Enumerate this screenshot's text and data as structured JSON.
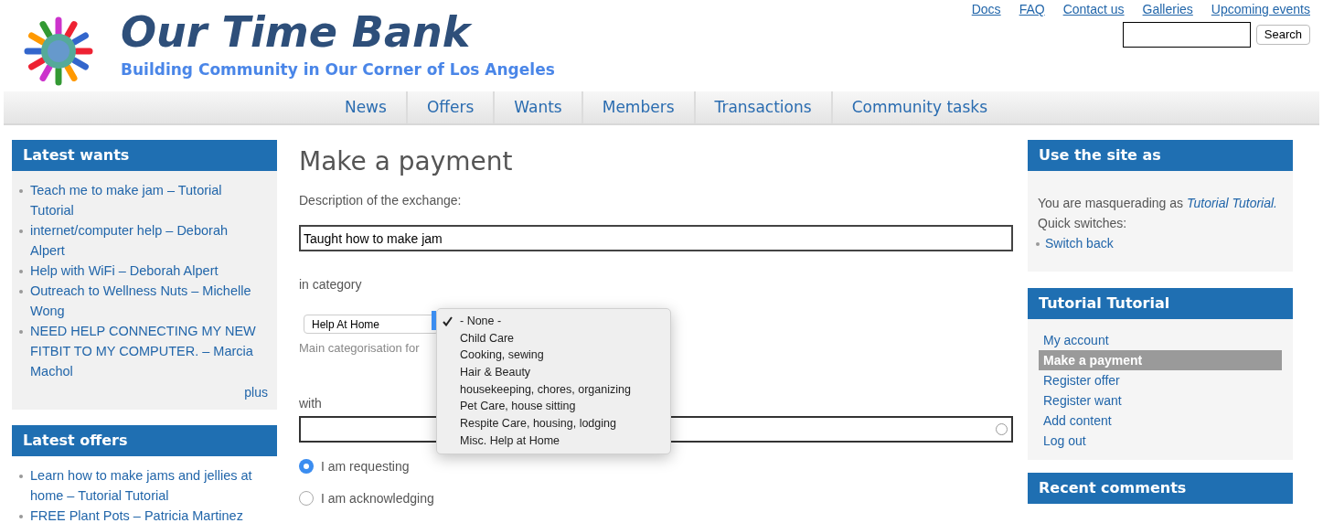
{
  "site": {
    "title": "Our Time Bank",
    "slogan": "Building Community in Our Corner of Los Angeles"
  },
  "top_links": [
    "Docs",
    "FAQ",
    "Contact us",
    "Galleries",
    "Upcoming events"
  ],
  "search": {
    "button": "Search"
  },
  "nav": [
    "News",
    "Offers",
    "Wants",
    "Members",
    "Transactions",
    "Community tasks"
  ],
  "latest_wants": {
    "title": "Latest wants",
    "items": [
      "Teach me to make jam – Tutorial Tutorial",
      "internet/computer help – Deborah Alpert",
      "Help with WiFi – Deborah Alpert",
      "Outreach to Wellness Nuts – Michelle Wong",
      "NEED HELP CONNECTING MY NEW FITBIT TO MY COMPUTER. – Marcia Machol"
    ],
    "more": "plus"
  },
  "latest_offers": {
    "title": "Latest offers",
    "items": [
      "Learn how to make jams and jellies at home – Tutorial Tutorial",
      "FREE Plant Pots – Patricia Martinez"
    ]
  },
  "form": {
    "title": "Make a payment",
    "description_label": "Description of the exchange:",
    "description_value": "Taught how to make jam",
    "category_label": "in category",
    "category_value": "Help At Home",
    "category_help": "Main categorisation for",
    "with_label": "with",
    "category_options": [
      {
        "label": "- None -",
        "selected": true
      },
      {
        "label": "Child Care",
        "selected": false
      },
      {
        "label": "Cooking, sewing",
        "selected": false
      },
      {
        "label": "Hair & Beauty",
        "selected": false
      },
      {
        "label": "housekeeping, chores, organizing",
        "selected": false
      },
      {
        "label": "Pet Care, house sitting",
        "selected": false
      },
      {
        "label": "Respite Care, housing, lodging",
        "selected": false
      },
      {
        "label": "Misc. Help at Home",
        "selected": false
      }
    ],
    "direction": [
      {
        "label": "I am requesting",
        "selected": true
      },
      {
        "label": "I am acknowledging",
        "selected": false
      }
    ]
  },
  "use_site_as": {
    "title": "Use the site as",
    "text": "You are masquerading as",
    "user": "Tutorial Tutorial.",
    "switches_label": "Quick switches:",
    "switches": [
      "Switch back"
    ]
  },
  "user_menu": {
    "title": "Tutorial Tutorial",
    "items": [
      {
        "label": "My account",
        "selected": false
      },
      {
        "label": "Make a payment",
        "selected": true
      },
      {
        "label": "Register offer",
        "selected": false
      },
      {
        "label": "Register want",
        "selected": false
      },
      {
        "label": "Add content",
        "selected": false
      },
      {
        "label": "Log out",
        "selected": false
      }
    ]
  },
  "recent_comments": {
    "title": "Recent comments"
  }
}
